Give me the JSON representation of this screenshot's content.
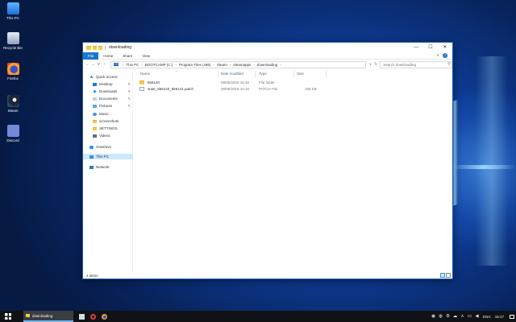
{
  "desktop": {
    "icons": [
      {
        "label": "This PC",
        "icon": "this-pc-icon"
      },
      {
        "label": "Recycle Bin",
        "icon": "recycle-bin-icon"
      },
      {
        "label": "Firefox",
        "icon": "firefox-icon"
      },
      {
        "label": "Steam",
        "icon": "steam-icon"
      },
      {
        "label": "Discord",
        "icon": "discord-icon"
      }
    ]
  },
  "window": {
    "title": "downloading",
    "controls": {
      "minimize": "—",
      "maximize": "☐",
      "close": "✕"
    },
    "ribbon_tabs": [
      "File",
      "Home",
      "Share",
      "View"
    ],
    "ribbon_toggle": "∨",
    "help": "?",
    "nav_buttons": {
      "back": "←",
      "forward": "→",
      "recent": "∨",
      "up": "↑"
    },
    "breadcrumb": [
      "This PC",
      "BOOTCAMP (C:)",
      "Program Files (x86)",
      "Steam",
      "steamapps",
      "downloading"
    ],
    "address_dropdown": "∨",
    "refresh": "↻",
    "search_placeholder": "Search downloading",
    "search_icon": "⚲",
    "nav_pane": [
      {
        "label": "Quick access",
        "icon": "star-icon",
        "pinned": false,
        "indent": 0
      },
      {
        "label": "Desktop",
        "icon": "desktop-folder-icon",
        "pinned": true,
        "indent": 1
      },
      {
        "label": "Downloads",
        "icon": "downloads-folder-icon",
        "pinned": true,
        "indent": 1
      },
      {
        "label": "Documents",
        "icon": "documents-folder-icon",
        "pinned": true,
        "indent": 1
      },
      {
        "label": "Pictures",
        "icon": "pictures-folder-icon",
        "pinned": true,
        "indent": 1
      },
      {
        "label": "Music",
        "icon": "music-folder-icon",
        "pinned": false,
        "indent": 1
      },
      {
        "label": "screenshots",
        "icon": "folder-icon",
        "pinned": false,
        "indent": 1
      },
      {
        "label": "SETTINGS",
        "icon": "folder-icon",
        "pinned": false,
        "indent": 1
      },
      {
        "label": "Videos",
        "icon": "videos-folder-icon",
        "pinned": false,
        "indent": 1
      },
      {
        "label": "OneDrive",
        "icon": "onedrive-icon",
        "pinned": false,
        "indent": 0
      },
      {
        "label": "This PC",
        "icon": "this-pc-icon",
        "pinned": false,
        "indent": 0,
        "selected": true
      },
      {
        "label": "Network",
        "icon": "network-icon",
        "pinned": false,
        "indent": 0
      }
    ],
    "pin_glyph": "✎",
    "columns": {
      "name": "Name",
      "date_modified": "Date modified",
      "type": "Type",
      "size": "Size"
    },
    "sort_caret": "^",
    "files": [
      {
        "name": "866140",
        "date": "09/06/2019 15:16",
        "type": "File folder",
        "size": "",
        "icon": "folder-icon"
      },
      {
        "name": "state_866140_866141.patch",
        "date": "09/06/2019 15:16",
        "type": "PATCH File",
        "size": "159 KB",
        "icon": "file-icon"
      }
    ],
    "status_text": "2 items"
  },
  "taskbar": {
    "task_label": "downloading",
    "pinned": [
      "mail-icon",
      "opera-icon",
      "firefox-icon"
    ],
    "tray": {
      "chevron": "∧",
      "language": "ENG",
      "time": "15:17"
    }
  },
  "colors": {
    "accent": "#1979ca",
    "selection": "#cce8ff",
    "folder": "#f6c94e",
    "taskbar": "#101215"
  }
}
